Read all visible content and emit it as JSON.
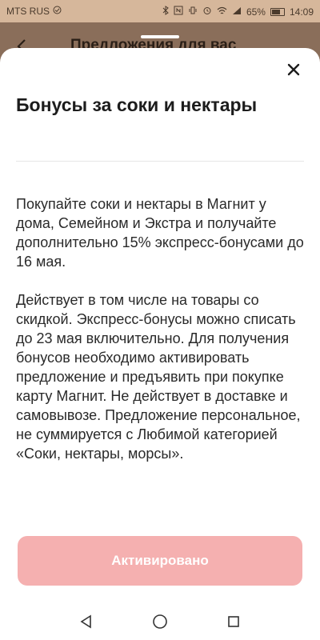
{
  "status_bar": {
    "carrier": "MTS RUS",
    "battery": "65%",
    "time": "14:09"
  },
  "background": {
    "title": "Предложения для вас"
  },
  "sheet": {
    "title": "Бонусы за соки и нектары",
    "paragraph_1": "Покупайте соки и нектары в Магнит у дома, Семейном и Экстра и получайте дополнительно 15% экспресс-бонусами до 16 мая.",
    "paragraph_2": "Действует в том числе на товары со скидкой. Экспресс-бонусы можно списать до 23 мая включительно. Для получения бонусов необходимо активировать предложение и предъявить при покупке карту Магнит. Не действует в доставке и самовывозе. Предложение персональное, не суммируется с Любимой категорией «Соки, нектары, морсы».",
    "button_label": "Активировано"
  },
  "colors": {
    "button_bg": "#f5b0b0",
    "sheet_bg": "#ffffff",
    "dim_bg": "#8a6e5a"
  },
  "icons": {
    "close": "close-icon",
    "back": "chevron-left-icon",
    "nav_back": "triangle-back-icon",
    "nav_home": "circle-home-icon",
    "nav_recents": "square-recents-icon"
  }
}
